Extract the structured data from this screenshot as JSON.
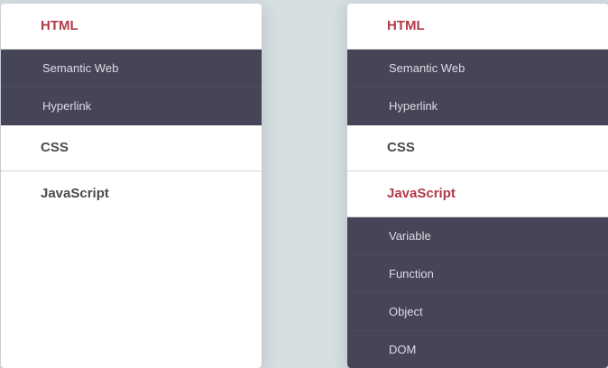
{
  "colors": {
    "page_background": "#d5dee0",
    "panel_background": "#ffffff",
    "submenu_background": "#464457",
    "active_header": "#b33a4a",
    "header_text": "#4a4a4a",
    "submenu_text": "#dcdce4"
  },
  "left_menu": {
    "html": {
      "label": "HTML",
      "items": [
        "Semantic Web",
        "Hyperlink"
      ]
    },
    "css": {
      "label": "CSS"
    },
    "javascript": {
      "label": "JavaScript"
    }
  },
  "right_menu": {
    "html": {
      "label": "HTML",
      "items": [
        "Semantic Web",
        "Hyperlink"
      ]
    },
    "css": {
      "label": "CSS"
    },
    "javascript": {
      "label": "JavaScript",
      "items": [
        "Variable",
        "Function",
        "Object",
        "DOM"
      ]
    }
  }
}
